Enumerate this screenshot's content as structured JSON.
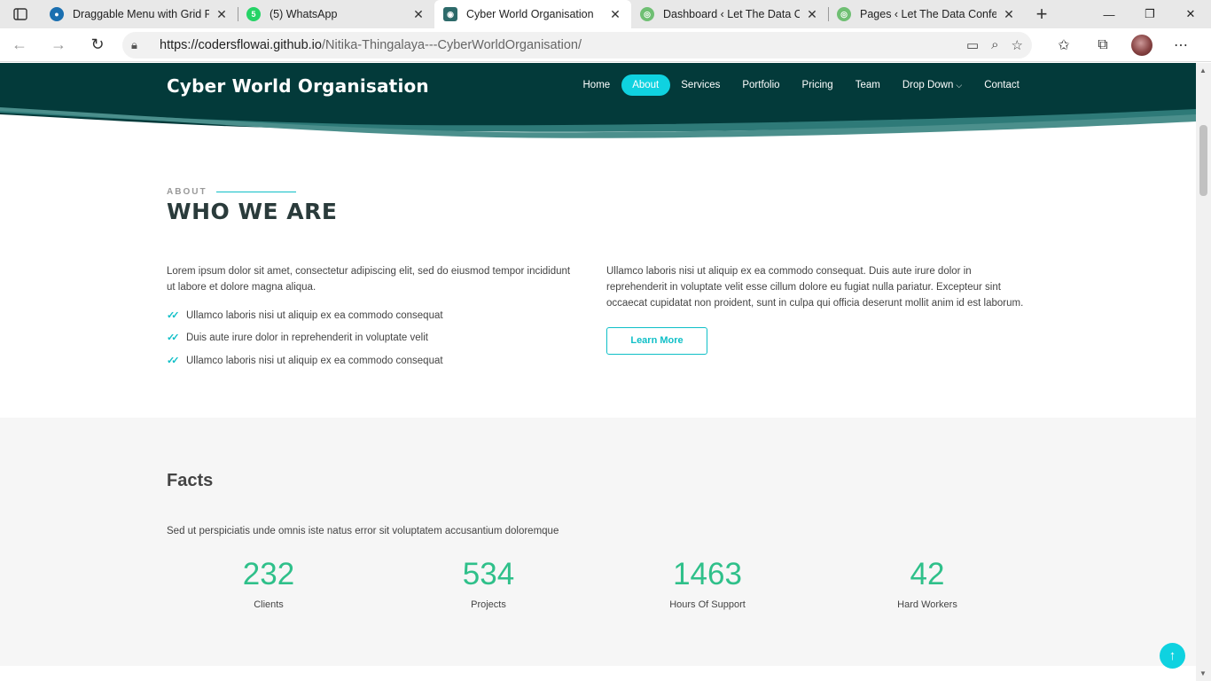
{
  "browser": {
    "tabs": [
      {
        "title": "Draggable Menu with Grid Pr",
        "favicon_color": "#1a6fb0",
        "active": false
      },
      {
        "title": "(5) WhatsApp",
        "favicon_color": "#25d366",
        "active": false
      },
      {
        "title": "Cyber World Organisation",
        "favicon_color": "#2d6a6a",
        "active": true
      },
      {
        "title": "Dashboard ‹ Let The Data Co",
        "favicon_color": "#6fbf73",
        "active": false
      },
      {
        "title": "Pages ‹ Let The Data Confess",
        "favicon_color": "#6fbf73",
        "active": false
      }
    ],
    "url_host": "https://codersflowai.github.io",
    "url_path": "/Nitika-Thingalaya---CyberWorldOrganisation/"
  },
  "site": {
    "logo": "Cyber World Organisation",
    "nav": [
      "Home",
      "About",
      "Services",
      "Portfolio",
      "Pricing",
      "Team",
      "Drop Down",
      "Contact"
    ],
    "active_nav": "About",
    "accent_color": "#0fd2e0",
    "header_color": "#033a3a"
  },
  "about": {
    "eyebrow": "ABOUT",
    "headline": "WHO WE ARE",
    "left_paragraph": "Lorem ipsum dolor sit amet, consectetur adipiscing elit, sed do eiusmod tempor incididunt ut labore et dolore magna aliqua.",
    "checklist": [
      "Ullamco laboris nisi ut aliquip ex ea commodo consequat",
      "Duis aute irure dolor in reprehenderit in voluptate velit",
      "Ullamco laboris nisi ut aliquip ex ea commodo consequat"
    ],
    "right_paragraph": "Ullamco laboris nisi ut aliquip ex ea commodo consequat. Duis aute irure dolor in reprehenderit in voluptate velit esse cillum dolore eu fugiat nulla pariatur. Excepteur sint occaecat cupidatat non proident, sunt in culpa qui officia deserunt mollit anim id est laborum.",
    "button": "Learn More"
  },
  "facts": {
    "title": "Facts",
    "subtitle": "Sed ut perspiciatis unde omnis iste natus error sit voluptatem accusantium doloremque",
    "counters": [
      {
        "value": "232",
        "label": "Clients"
      },
      {
        "value": "534",
        "label": "Projects"
      },
      {
        "value": "1463",
        "label": "Hours Of Support"
      },
      {
        "value": "42",
        "label": "Hard Workers"
      }
    ],
    "number_color": "#2fc08a"
  },
  "icons": {
    "back_to_top": "arrow-up-icon"
  }
}
